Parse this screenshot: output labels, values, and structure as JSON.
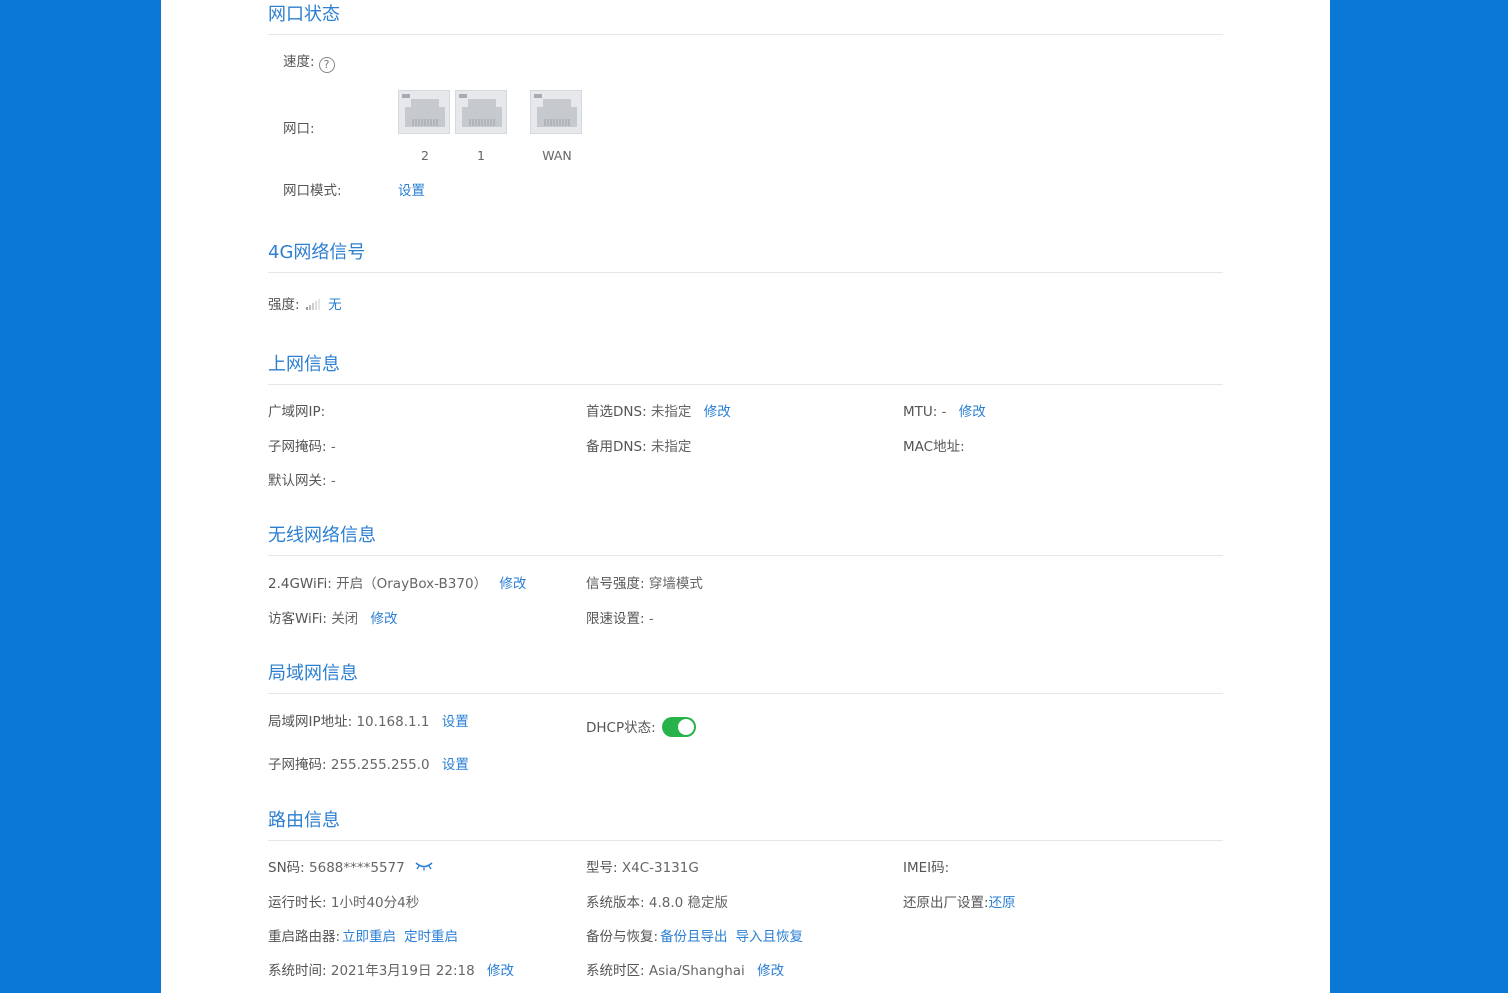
{
  "port_status": {
    "title": "网口状态",
    "speed_label": "速度:",
    "help_glyph": "?",
    "ports_label": "网口:",
    "ports": [
      "2",
      "1",
      "WAN"
    ],
    "port_mode_label": "网口模式:",
    "port_mode_link": "设置"
  },
  "signal_4g": {
    "title": "4G网络信号",
    "strength_label": "强度:",
    "strength_value": "无"
  },
  "internet": {
    "title": "上网信息",
    "wan_ip_label": "广域网IP:",
    "subnet_label": "子网掩码:",
    "subnet_value": "-",
    "gateway_label": "默认网关:",
    "gateway_value": "-",
    "dns1_label": "首选DNS:",
    "dns1_value": "未指定",
    "dns1_link": "修改",
    "dns2_label": "备用DNS:",
    "dns2_value": "未指定",
    "mtu_label": "MTU:",
    "mtu_value": "-",
    "mtu_link": "修改",
    "mac_label": "MAC地址:"
  },
  "wireless": {
    "title": "无线网络信息",
    "wifi24_label": "2.4GWiFi:",
    "wifi24_value": "开启（OrayBox-B370）",
    "wifi24_link": "修改",
    "guest_label": "访客WiFi:",
    "guest_value": "关闭",
    "guest_link": "修改",
    "signal_label": "信号强度:",
    "signal_value": "穿墙模式",
    "limit_label": "限速设置:",
    "limit_value": "-"
  },
  "lan": {
    "title": "局域网信息",
    "ip_label": "局域网IP地址:",
    "ip_value": "10.168.1.1",
    "ip_link": "设置",
    "mask_label": "子网掩码:",
    "mask_value": "255.255.255.0",
    "mask_link": "设置",
    "dhcp_label": "DHCP状态:"
  },
  "router": {
    "title": "路由信息",
    "sn_label": "SN码:",
    "sn_value": "5688****5577",
    "uptime_label": "运行时长:",
    "uptime_value": "1小时40分4秒",
    "reboot_label": "重启路由器:",
    "reboot_now": "立即重启",
    "reboot_timed": "定时重启",
    "time_label": "系统时间:",
    "time_value": "2021年3月19日 22:18",
    "time_link": "修改",
    "model_label": "型号:",
    "model_value": "X4C-3131G",
    "version_label": "系统版本:",
    "version_value": "4.8.0 稳定版",
    "backup_label": "备份与恢复:",
    "backup_export": "备份且导出",
    "backup_import": "导入且恢复",
    "tz_label": "系统时区:",
    "tz_value": "Asia/Shanghai",
    "tz_link": "修改",
    "imei_label": "IMEI码:",
    "reset_label": "还原出厂设置:",
    "reset_link": "还原"
  }
}
